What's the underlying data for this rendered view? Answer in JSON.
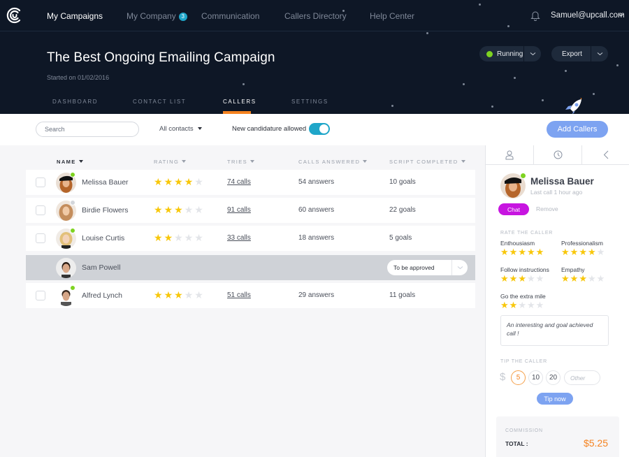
{
  "nav": {
    "items": [
      {
        "label": "My Campaigns",
        "active": true
      },
      {
        "label": "My Company",
        "badge": "3"
      },
      {
        "label": "Communication"
      },
      {
        "label": "Callers Directory"
      },
      {
        "label": "Help Center"
      }
    ],
    "user_email": "Samuel@upcall.com"
  },
  "campaign": {
    "title": "The Best Ongoing Emailing Campaign",
    "started": "Started on 01/02/2016",
    "status_label": "Running",
    "status_color": "#7ed321",
    "export_label": "Export"
  },
  "subtabs": [
    {
      "label": "DASHBOARD"
    },
    {
      "label": "CONTACT LIST"
    },
    {
      "label": "CALLERS",
      "active": true
    },
    {
      "label": "SETTINGS"
    }
  ],
  "toolbar": {
    "search_placeholder": "Search",
    "filter_label": "All contacts",
    "toggle_label": "New candidature allowed",
    "toggle_on": true,
    "add_callers_label": "Add Callers"
  },
  "table": {
    "columns": [
      "NAME",
      "RATING",
      "TRIES",
      "CALLS ANSWERED",
      "SCRIPT COMPLETED"
    ],
    "rows": [
      {
        "name": "Melissa Bauer",
        "rating": 4,
        "tries": "74 calls",
        "answers": "54 answers",
        "goals": "10 goals",
        "online": true
      },
      {
        "name": "Birdie Flowers",
        "rating": 3,
        "tries": "91 calls",
        "answers": "60 answers",
        "goals": "22 goals",
        "online": false
      },
      {
        "name": "Louise Curtis",
        "rating": 2,
        "tries": "33 calls",
        "answers": "18 answers",
        "goals": "5 goals",
        "online": true
      },
      {
        "name": "Sam Powell",
        "pending": true,
        "status": "To be approved"
      },
      {
        "name": "Alfred Lynch",
        "rating": 3,
        "tries": "51 calls",
        "answers": "29 answers",
        "goals": "11 goals",
        "online": true
      }
    ]
  },
  "panel": {
    "name": "Melissa Bauer",
    "last_call": "Last call 1 hour ago",
    "chat_label": "Chat",
    "remove_label": "Remove",
    "rate_label": "RATE THE CALLER",
    "criteria": [
      {
        "label": "Enthousiasm",
        "rating": 5
      },
      {
        "label": "Professionalism",
        "rating": 4
      },
      {
        "label": "Follow instructions",
        "rating": 3
      },
      {
        "label": "Empathy",
        "rating": 3
      },
      {
        "label": "Go the extra mile",
        "rating": 2
      }
    ],
    "comment": "An interesting and goal achieved call !",
    "tip_label": "TIP THE CALLER",
    "currency": "$",
    "tip_options": [
      "5",
      "10",
      "20"
    ],
    "tip_selected": "5",
    "tip_other_placeholder": "Other",
    "tip_now_label": "Tip now",
    "commission_label": "COMMISSION",
    "total_label": "TOTAL :",
    "total_value": "$5.25"
  }
}
